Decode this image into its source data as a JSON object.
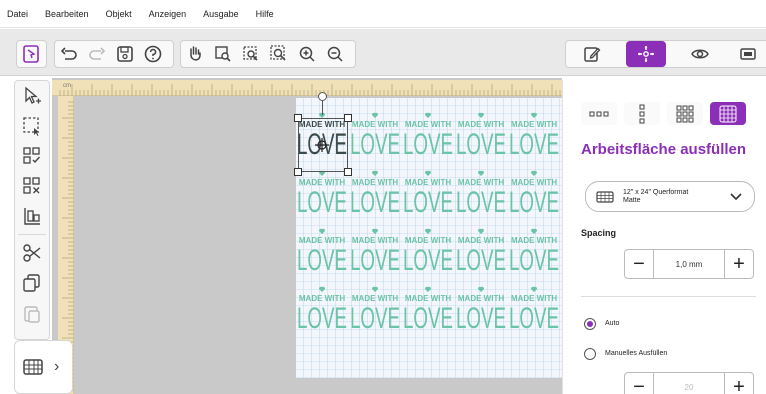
{
  "menu": {
    "items": [
      "Datei",
      "Bearbeiten",
      "Objekt",
      "Anzeigen",
      "Ausgabe",
      "Hilfe"
    ]
  },
  "toolbar": {
    "groups": {
      "file": [
        "select-tool-icon"
      ],
      "edit": [
        "undo-icon",
        "redo-icon",
        "save-icon",
        "help-icon"
      ],
      "view": [
        "hand-icon",
        "zoom-area-icon",
        "zoom-fit-icon",
        "zoom-selection-icon",
        "zoom-in-icon",
        "zoom-out-icon"
      ],
      "mode": [
        "edit-mode-icon",
        "fill-mode-icon",
        "preview-icon",
        "send-icon"
      ]
    },
    "active_mode": "fill-mode-icon"
  },
  "left_tools": [
    "select-add-icon",
    "select-box-icon",
    "group-icon",
    "ungroup-icon",
    "align-icon",
    "cut-icon",
    "copy-icon",
    "paste-icon"
  ],
  "bottom_panel": {
    "icon": "mat-icon",
    "arrow": "›"
  },
  "ruler": {
    "corner_label": "cm"
  },
  "design": {
    "top_text": "MADE WITH",
    "main_text": "LOVE",
    "colors": {
      "accent": "#8b2fb8",
      "design_green": "#6bc3a8",
      "design_dark": "#3a4a48",
      "grid_blue": "#9cc2e8"
    }
  },
  "panel": {
    "grid_options": [
      "1x3",
      "3x1",
      "3x3",
      "fill"
    ],
    "active_grid": "fill",
    "title": "Arbeitsfläche ausfüllen",
    "mat_select": {
      "line1": "12\" x 24\" Querformat",
      "line2": "Matte"
    },
    "spacing_label": "Spacing",
    "spacing_value": "1,0 mm",
    "options": {
      "auto_label": "Auto",
      "manual_label": "Manuelles Ausfüllen",
      "selected": "auto"
    },
    "manual_value": "20"
  }
}
